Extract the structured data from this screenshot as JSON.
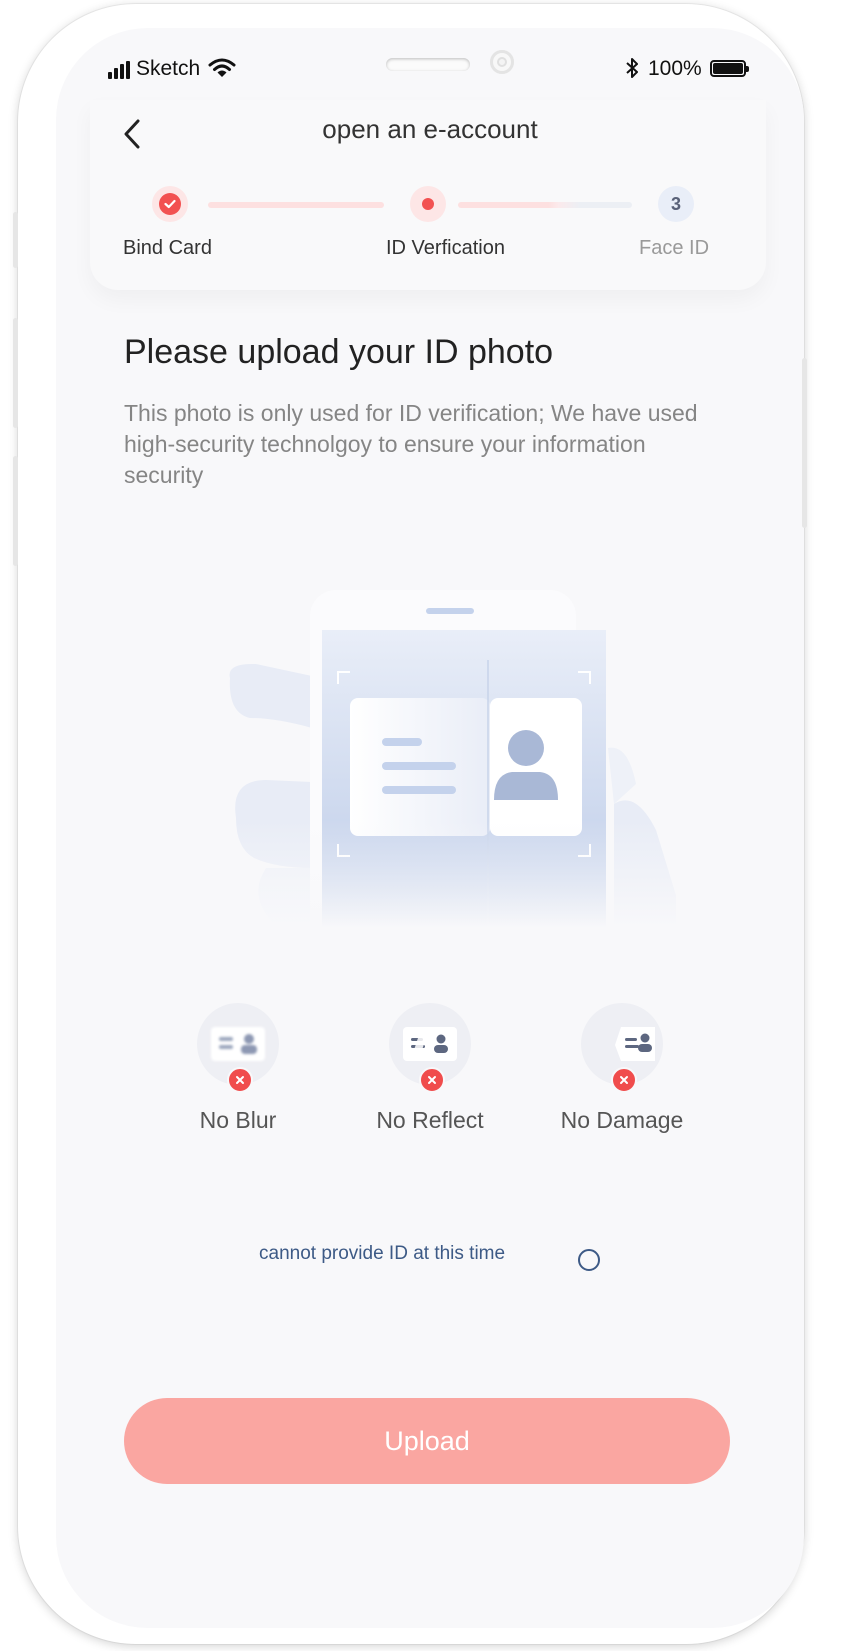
{
  "status_bar": {
    "carrier": "Sketch",
    "battery": "100%",
    "icons": [
      "signal-icon",
      "wifi-icon",
      "bluetooth-icon",
      "battery-icon"
    ]
  },
  "header": {
    "title": "open an e-account",
    "back_icon": "chevron-left-icon"
  },
  "steps": [
    {
      "label": "Bind Card",
      "state": "done"
    },
    {
      "label": "ID Verfication",
      "state": "active"
    },
    {
      "label": "Face ID",
      "number": "3",
      "state": "pending"
    }
  ],
  "main": {
    "heading": "Please upload your ID photo",
    "description": "This photo is only used for ID verification; We have used high-security technolgoy to ensure your information security"
  },
  "tips": [
    {
      "label": "No Blur"
    },
    {
      "label": "No Reflect"
    },
    {
      "label": "No Damage"
    }
  ],
  "no_id": {
    "label": "cannot provide ID at this time",
    "checked": false
  },
  "upload_button": "Upload",
  "colors": {
    "accent": "#f25151",
    "accent_light": "#fde6e6",
    "button": "#faa6a1",
    "link": "#3d5a86",
    "illustration": "#c4d2ec"
  }
}
